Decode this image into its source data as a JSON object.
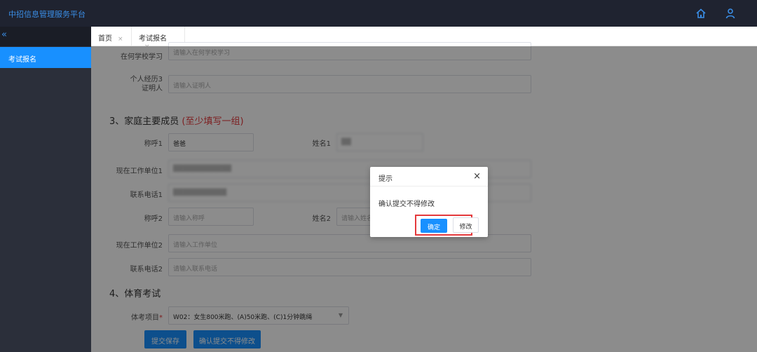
{
  "app": {
    "title": "中招信息管理服务平台"
  },
  "header": {
    "home_icon": "home-icon",
    "user_icon": "user-icon"
  },
  "sidebar": {
    "collapse_label": "«",
    "items": [
      {
        "label": "考试报名",
        "active": true
      }
    ]
  },
  "tabs": [
    {
      "label": "首页",
      "close": "×"
    },
    {
      "label": "考试报名",
      "close": "×"
    }
  ],
  "form": {
    "school_label": "在何学校学习",
    "school_placeholder": "请输入在何学校学习",
    "witness_label_1": "个人经历3",
    "witness_label_2": "证明人",
    "witness_placeholder": "请输入证明人",
    "section3_title": "3、家庭主要成员",
    "section3_note": "(至少填写一组)",
    "title1_label": "称呼1",
    "title1_value": "爸爸",
    "name1_label": "姓名1",
    "name1_value": "██",
    "work1_label": "现在工作单位1",
    "work1_value": "████████████",
    "phone1_label": "联系电话1",
    "phone1_value": "███████████",
    "title2_label": "称呼2",
    "title2_placeholder": "请输入称呼",
    "name2_label": "姓名2",
    "name2_placeholder": "请输入姓名",
    "work2_label": "现在工作单位2",
    "work2_placeholder": "请输入工作单位",
    "phone2_label": "联系电话2",
    "phone2_placeholder": "请输入联系电话",
    "section4_title": "4、体育考试",
    "pe_label": "体考项目",
    "pe_required": "*",
    "pe_value": "W02：女生800米跑、(A)50米跑、(C)1分钟跳绳",
    "save_button": "提交保存",
    "confirm_submit_button": "确认提交不得修改"
  },
  "dialog": {
    "title": "提示",
    "close": "×",
    "message": "确认提交不得修改",
    "ok_label": "确定",
    "edit_label": "修改"
  },
  "colors": {
    "accent": "#1890ff",
    "topbar": "#1f2330",
    "sidebar": "#2b2f3a",
    "highlight": "#e4393c"
  }
}
